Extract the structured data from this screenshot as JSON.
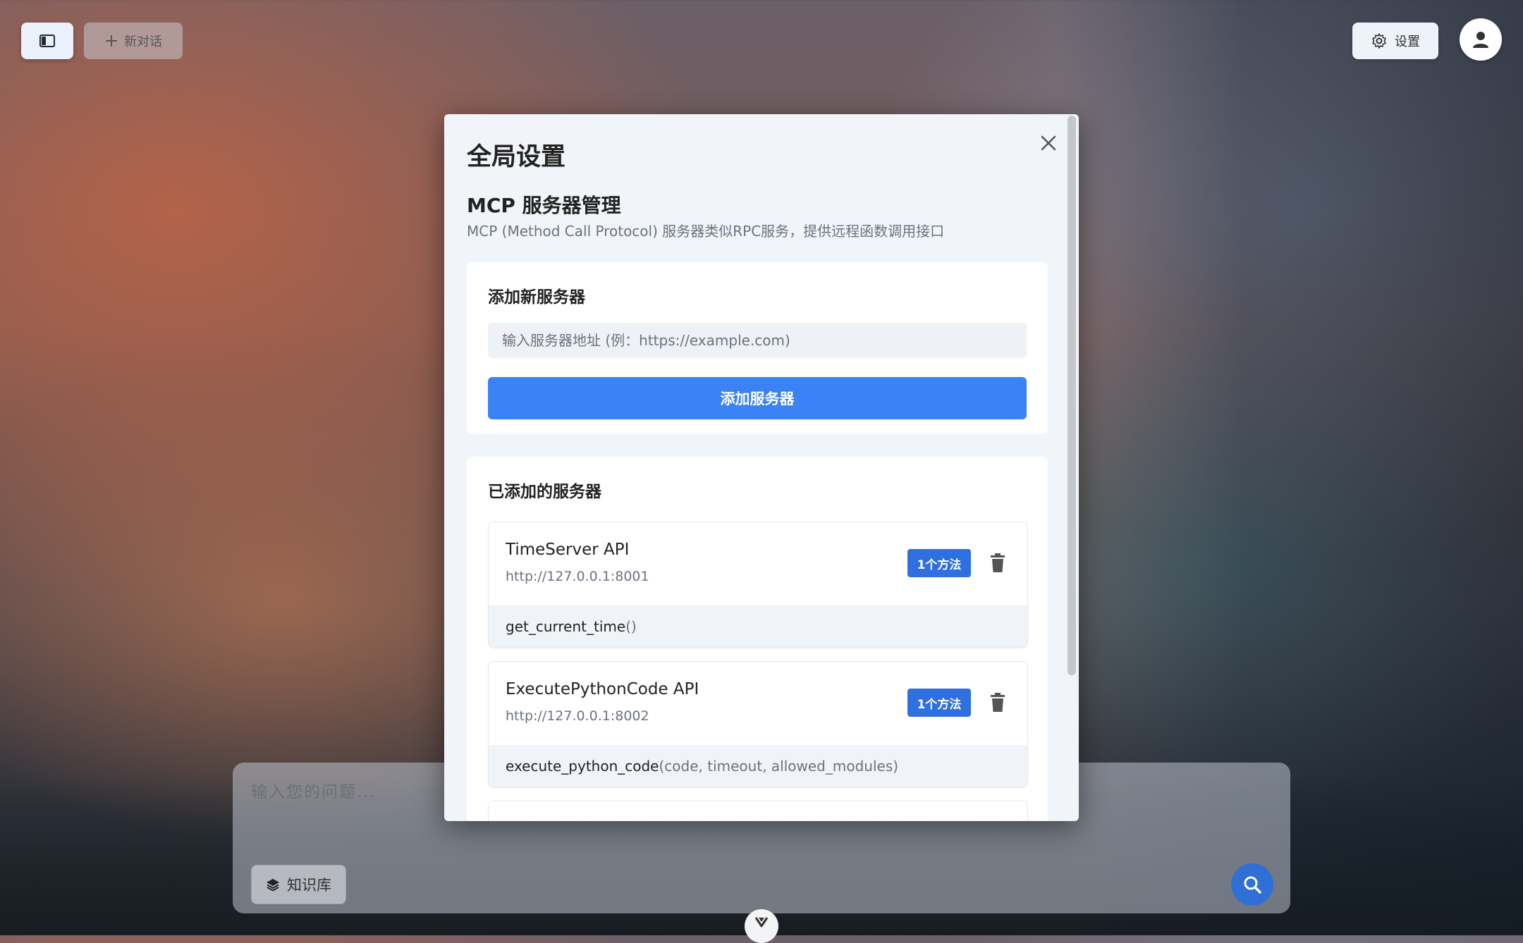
{
  "toolbar": {
    "new_chat_label": "新对话",
    "settings_label": "设置"
  },
  "chat": {
    "placeholder": "输入您的问题...",
    "knowledge_base_label": "知识库"
  },
  "modal": {
    "title": "全局设置",
    "section_title": "MCP 服务器管理",
    "section_desc": "MCP (Method Call Protocol) 服务器类似RPC服务，提供远程函数调用接口",
    "add_card": {
      "title": "添加新服务器",
      "input_placeholder": "输入服务器地址 (例：https://example.com)",
      "add_button_label": "添加服务器"
    },
    "list_card": {
      "title": "已添加的服务器",
      "servers": [
        {
          "name": "TimeServer API",
          "url": "http://127.0.0.1:8001",
          "badge": "1个方法",
          "method_name": "get_current_time",
          "method_params": "()"
        },
        {
          "name": "ExecutePythonCode API",
          "url": "http://127.0.0.1:8002",
          "badge": "1个方法",
          "method_name": "execute_python_code",
          "method_params": "(code, timeout, allowed_modules)"
        }
      ]
    }
  },
  "colors": {
    "accent": "#3b82f6",
    "badge": "#2f6fe0",
    "send": "#2f6fd6"
  },
  "icons": {
    "sidebar_toggle": "sidebar-icon",
    "new_chat": "plus-icon",
    "settings": "gear-icon",
    "avatar": "user-icon",
    "close": "close-icon",
    "delete": "trash-icon",
    "knowledge": "layers-icon",
    "send": "search-icon",
    "scroll": "chevron-down-icon"
  }
}
